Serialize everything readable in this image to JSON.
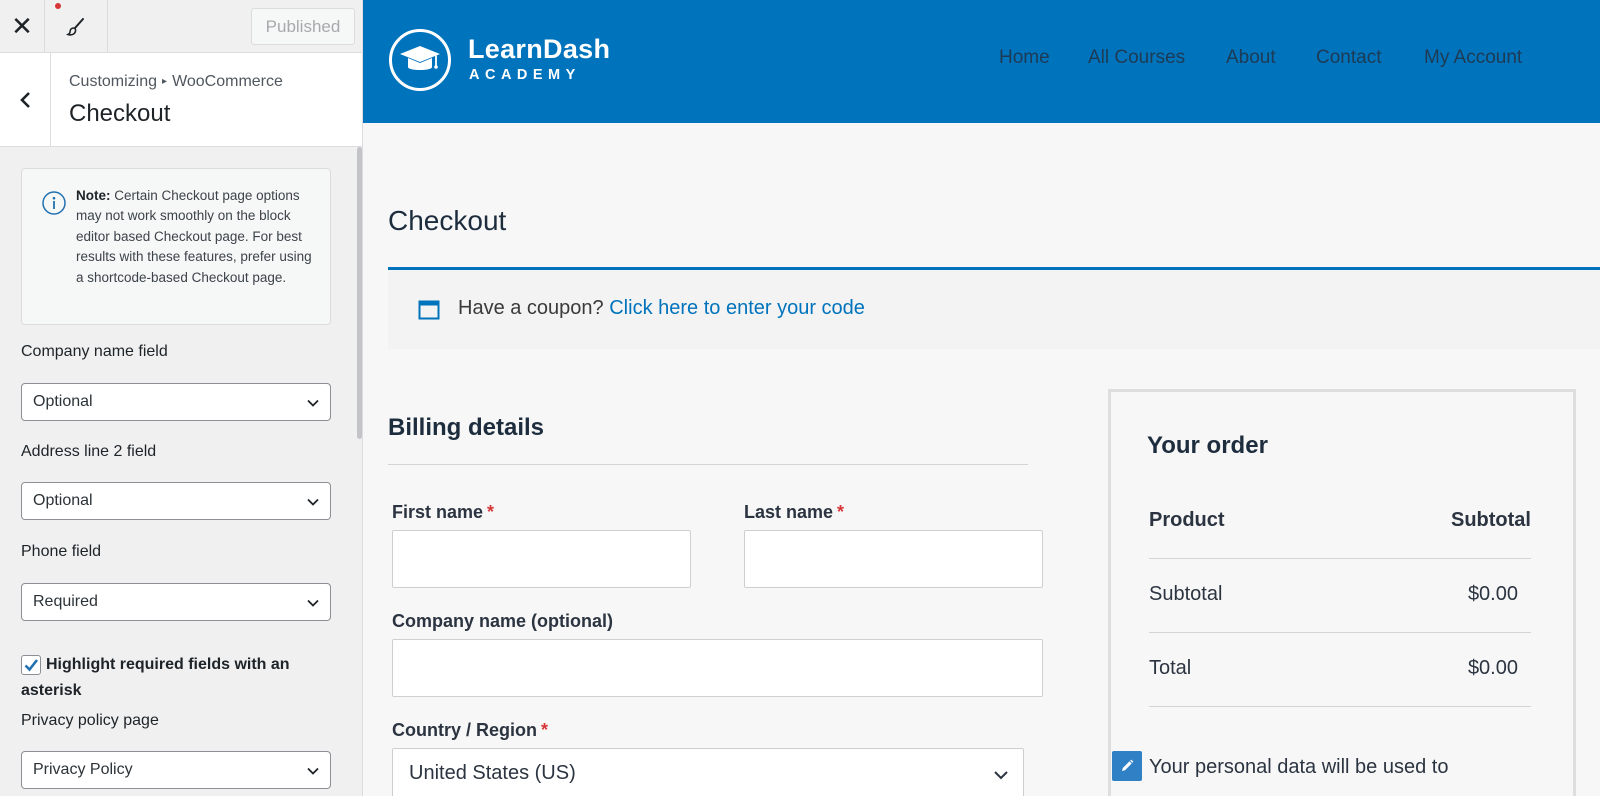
{
  "customizer": {
    "close_icon_glyph": "✕",
    "publish_label": "Published",
    "breadcrumb": {
      "root": "Customizing",
      "separator": "▸",
      "parent": "WooCommerce"
    },
    "section_title": "Checkout",
    "note": {
      "label": "Note:",
      "text": "Certain Checkout page options may not work smoothly on the block editor based Checkout page. For best results with these features, prefer using a shortcode-based Checkout page."
    },
    "controls": [
      {
        "label": "Company name field",
        "value": "Optional"
      },
      {
        "label": "Address line 2 field",
        "value": "Optional"
      },
      {
        "label": "Phone field",
        "value": "Required"
      }
    ],
    "highlight_required": {
      "label": "Highlight required fields with an asterisk",
      "checked": true
    },
    "privacy_policy": {
      "label": "Privacy policy page",
      "value": "Privacy Policy"
    }
  },
  "site": {
    "brand_color": "#0073bd",
    "logo": {
      "name": "LearnDash",
      "tagline": "ACADEMY"
    },
    "nav": [
      "Home",
      "All Courses",
      "About",
      "Contact",
      "My Account"
    ]
  },
  "checkout": {
    "title": "Checkout",
    "coupon": {
      "prompt": "Have a coupon?",
      "link": "Click here to enter your code"
    },
    "billing": {
      "title": "Billing details",
      "required_mark": "*",
      "fields": {
        "first_name": "First name",
        "last_name": "Last name",
        "company": "Company name (optional)",
        "country": "Country / Region"
      },
      "country_value": "United States (US)"
    },
    "order": {
      "title": "Your order",
      "header": {
        "product": "Product",
        "subtotal": "Subtotal"
      },
      "rows": [
        {
          "label": "Subtotal",
          "value": "$0.00"
        },
        {
          "label": "Total",
          "value": "$0.00"
        }
      ],
      "privacy_text": "Your personal data will be used to"
    }
  }
}
